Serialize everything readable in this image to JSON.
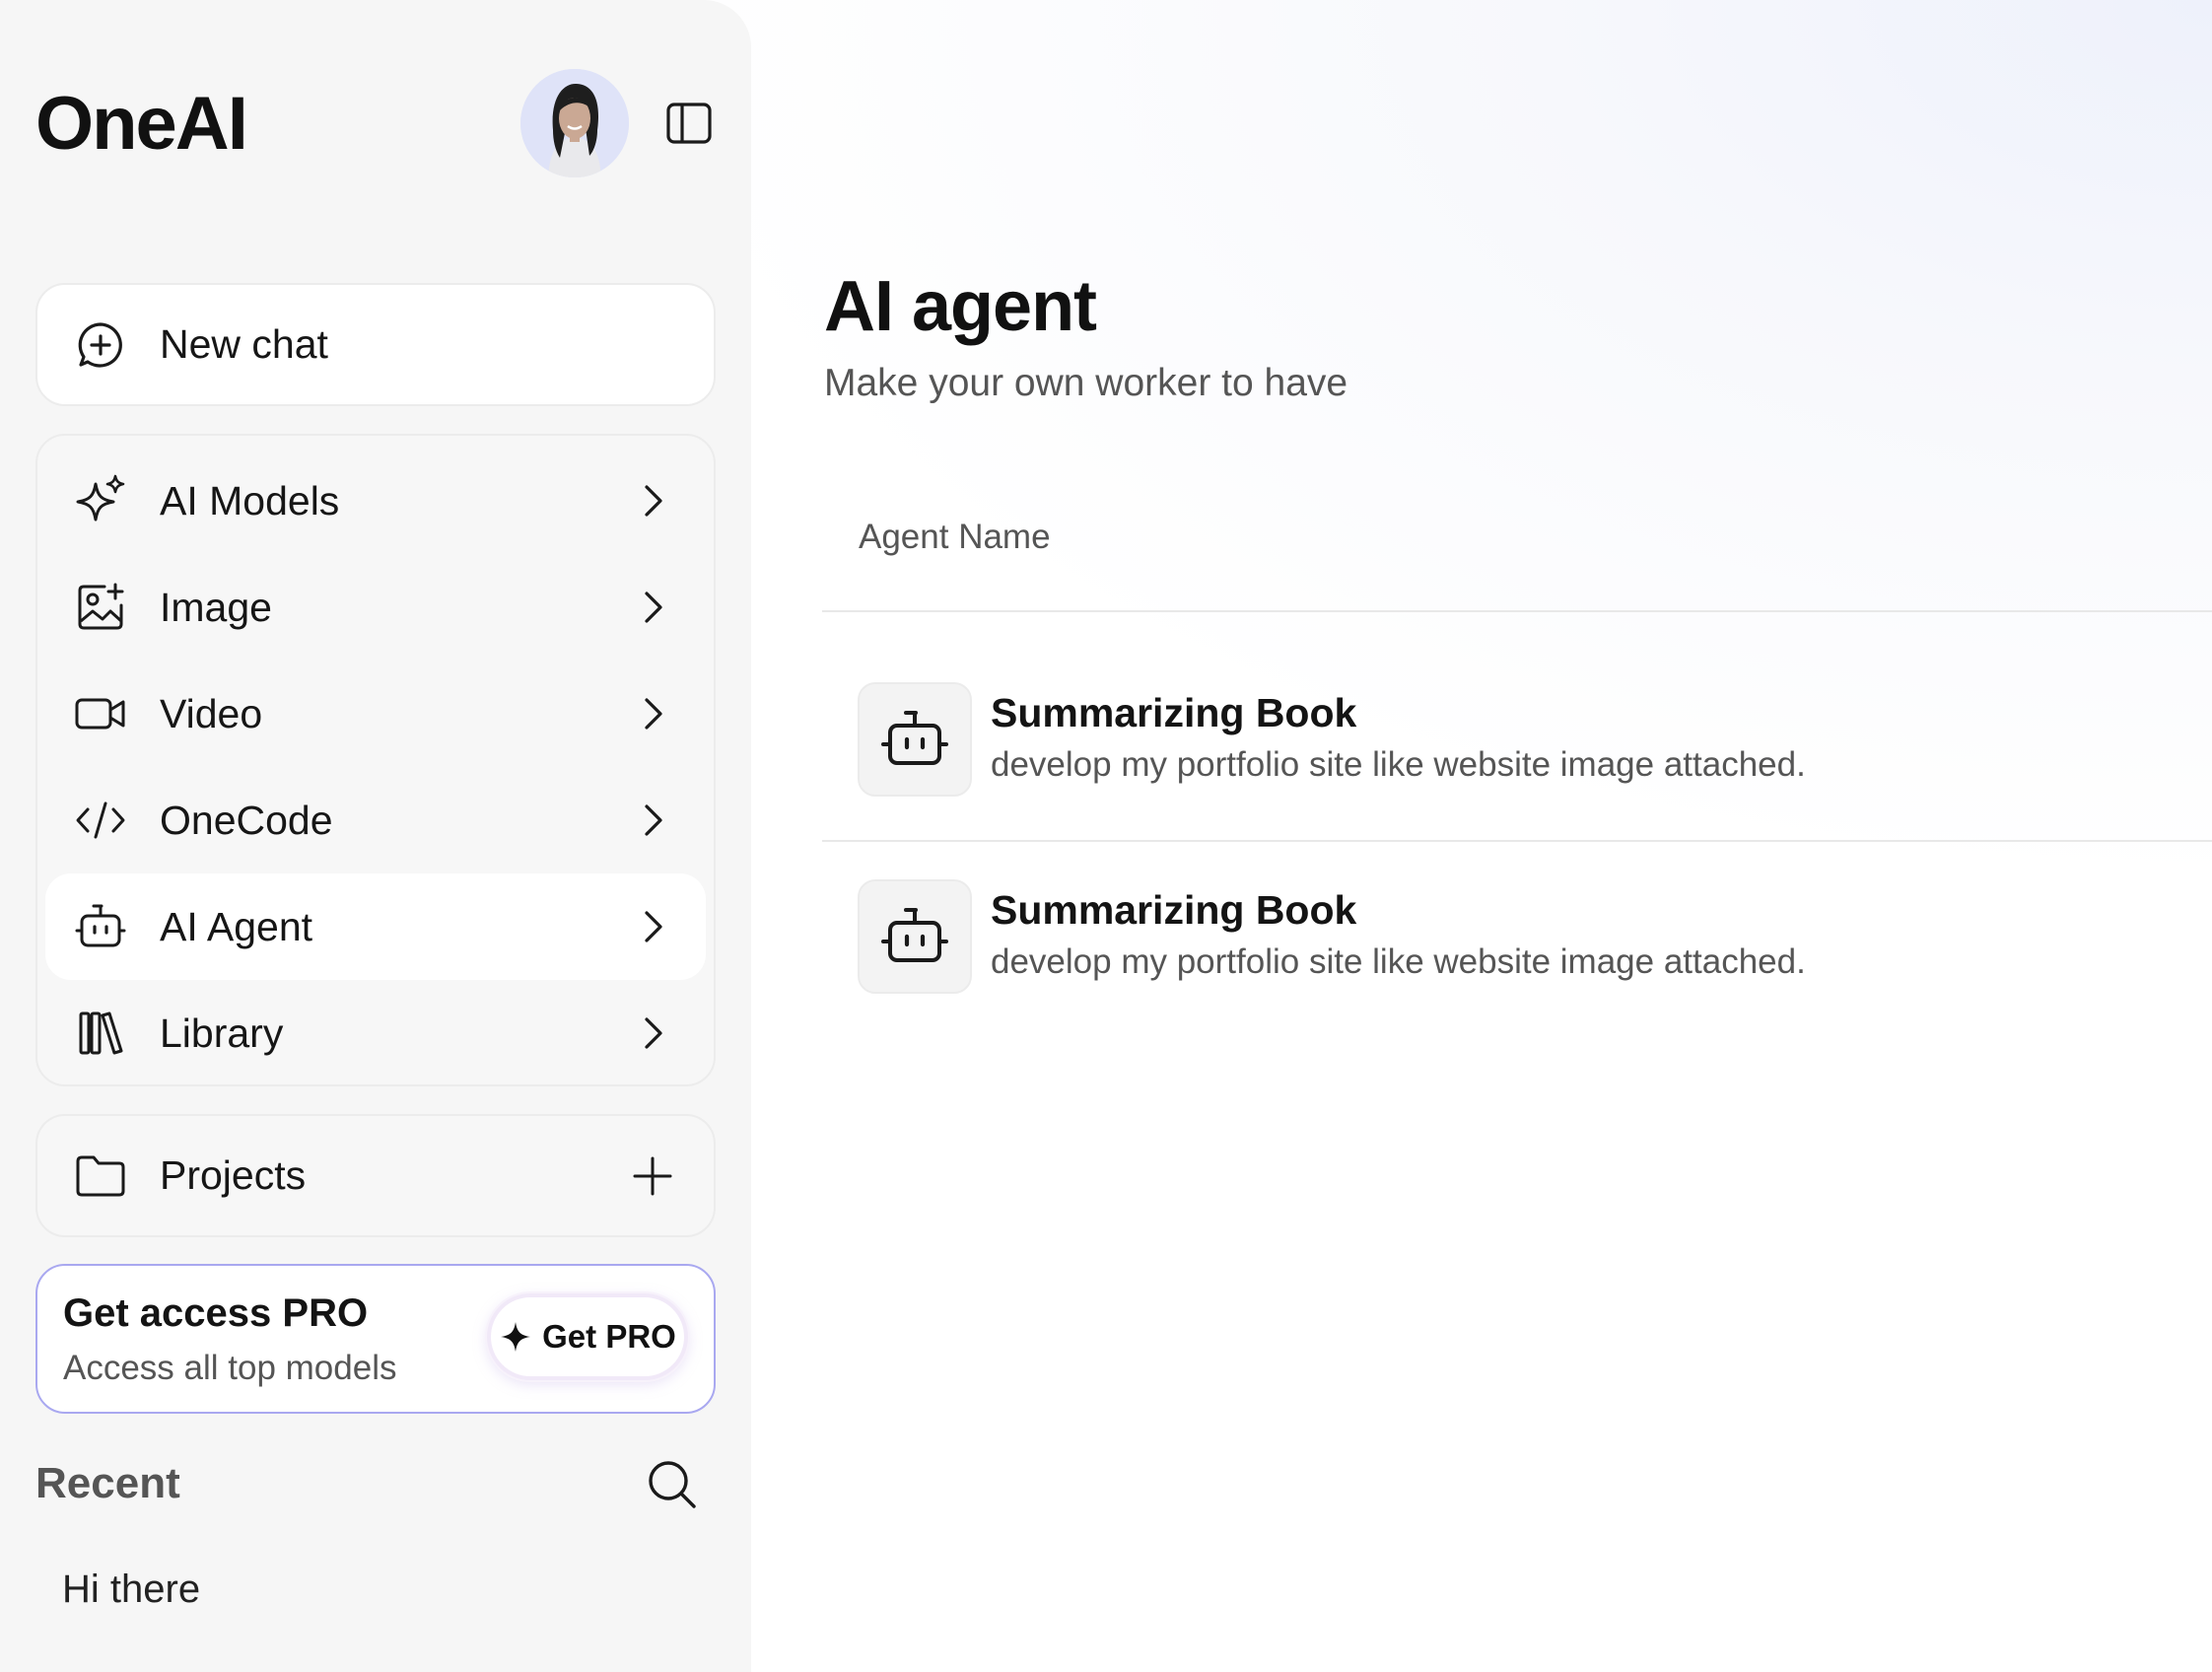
{
  "app": {
    "brand": "OneAI"
  },
  "sidebar": {
    "new_chat_label": "New chat",
    "menu": [
      {
        "label": "AI Models",
        "icon": "sparkle-icon"
      },
      {
        "label": "Image",
        "icon": "image-icon"
      },
      {
        "label": "Video",
        "icon": "video-icon"
      },
      {
        "label": "OneCode",
        "icon": "code-icon"
      },
      {
        "label": "AI Agent",
        "icon": "robot-icon",
        "active": true
      },
      {
        "label": "Library",
        "icon": "library-icon"
      }
    ],
    "projects_label": "Projects",
    "pro": {
      "title": "Get access PRO",
      "subtitle": "Access all top models",
      "button_label": "Get PRO"
    },
    "recent": {
      "title": "Recent",
      "items": [
        "Hi there"
      ]
    }
  },
  "main": {
    "title": "AI agent",
    "subtitle": "Make your own worker to have",
    "column_header": "Agent Name",
    "agents": [
      {
        "name": "Summarizing Book",
        "description": "develop my portfolio site like website image attached."
      },
      {
        "name": "Summarizing Book",
        "description": "develop my portfolio site like website image attached."
      }
    ]
  },
  "colors": {
    "accent_border": "#a9a8f0",
    "sidebar_bg": "#f6f6f6",
    "active_item_bg": "#ffffff"
  }
}
